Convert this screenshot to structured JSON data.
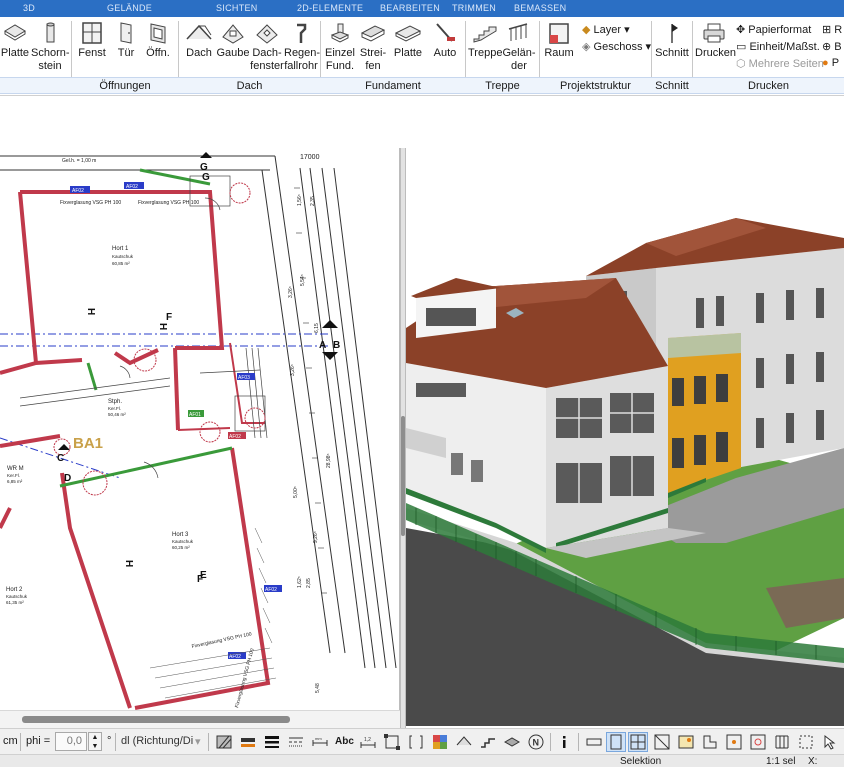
{
  "tabs": [
    "3D",
    "GELÄNDE",
    "SICHTEN",
    "2D-ELEMENTE",
    "BEARBEITEN",
    "TRIMMEN",
    "BEMASSEN"
  ],
  "ribbon": {
    "buttons": {
      "platte1": "Platte",
      "schornstein": "Schorn-\nstein",
      "fenst": "Fenst",
      "tuer": "Tür",
      "oeffn": "Öffn.",
      "dach": "Dach",
      "gaube": "Gaube",
      "dachfenster": "Dach-\nfenster",
      "regenfallrohr": "Regen-\nfallrohr",
      "einzelfund": "Einzel\nFund.",
      "streifen": "Strei-\nfen",
      "platte2": "Platte",
      "auto": "Auto",
      "treppe": "Treppe",
      "gelaender": "Gelän-\nder",
      "raum": "Raum",
      "schnitt": "Schnitt",
      "drucken": "Drucken"
    },
    "small": {
      "layer": "Layer ▾",
      "geschoss": "Geschoss ▾",
      "papierformat": "Papierformat",
      "einheit": "Einheit/Maßst.",
      "mehrere_seiten": "Mehrere Seiten",
      "r": "R",
      "b": "B",
      "p": "P"
    },
    "groups": {
      "oeffnungen": "Öffnungen",
      "dach": "Dach",
      "fundament": "Fundament",
      "treppe": "Treppe",
      "projektstruktur": "Projektstruktur",
      "schnitt": "Schnitt",
      "drucken": "Drucken"
    }
  },
  "plan": {
    "dim_top": "17000",
    "dim_top_small": "Gel.h. = 1,00 m",
    "ba1": "BA1",
    "rooms": [
      {
        "name": "Hort 1",
        "sub": "Kautschuk",
        "area": "60,85 m²"
      },
      {
        "name": "Stph.",
        "sub": "Ker.Fl.",
        "area": "50,46 m²"
      },
      {
        "name": "WR M",
        "sub": "Ker.Fl.",
        "area": "6,85 m²"
      },
      {
        "name": "Hort 3",
        "sub": "Kautschuk",
        "area": "60,25 m²"
      },
      {
        "name": "Hort 2",
        "sub": "Kautschuk",
        "area": "61,35 m²"
      }
    ],
    "glazing_labels": [
      "Fixverglasung VSG PH 100",
      "Fixverglasung VSG PH 100",
      "Fixverglasung VSG PH 100",
      "Fixverglasung VSG PH 100"
    ],
    "section_marks": [
      "G",
      "G",
      "H",
      "H",
      "A",
      "B",
      "C",
      "D",
      "E",
      "F",
      "F",
      "H",
      "E"
    ],
    "tags": [
      "AF02",
      "AF02",
      "AF03",
      "AF01",
      "AF02",
      "AF02",
      "AF02"
    ],
    "dims_right": [
      "1,56⁵",
      "2,35",
      "5,54⁵",
      "3,26⁵",
      "6,15",
      "3,26⁵",
      "28,98⁵",
      "5,00⁵",
      "9,26⁵",
      "1,62⁵",
      "2,85",
      "5,48"
    ]
  },
  "bottom": {
    "unit": "cm",
    "phi_label": "phi =",
    "phi_value": "0,0",
    "degree": "°",
    "dl_label": "dl (Richtung/Di"
  },
  "status": {
    "mode": "Selektion",
    "scale": "1:1 sel",
    "x": "X:"
  },
  "colors": {
    "tabbar": "#2b6fc4",
    "wall_red": "#c0394b",
    "wall_green": "#3a9a3a",
    "axis_blue": "#2a3cc8",
    "roof": "#8b4128",
    "facade_orange": "#e0a020",
    "lawn": "#5fa043",
    "road": "#4a4a4a"
  }
}
